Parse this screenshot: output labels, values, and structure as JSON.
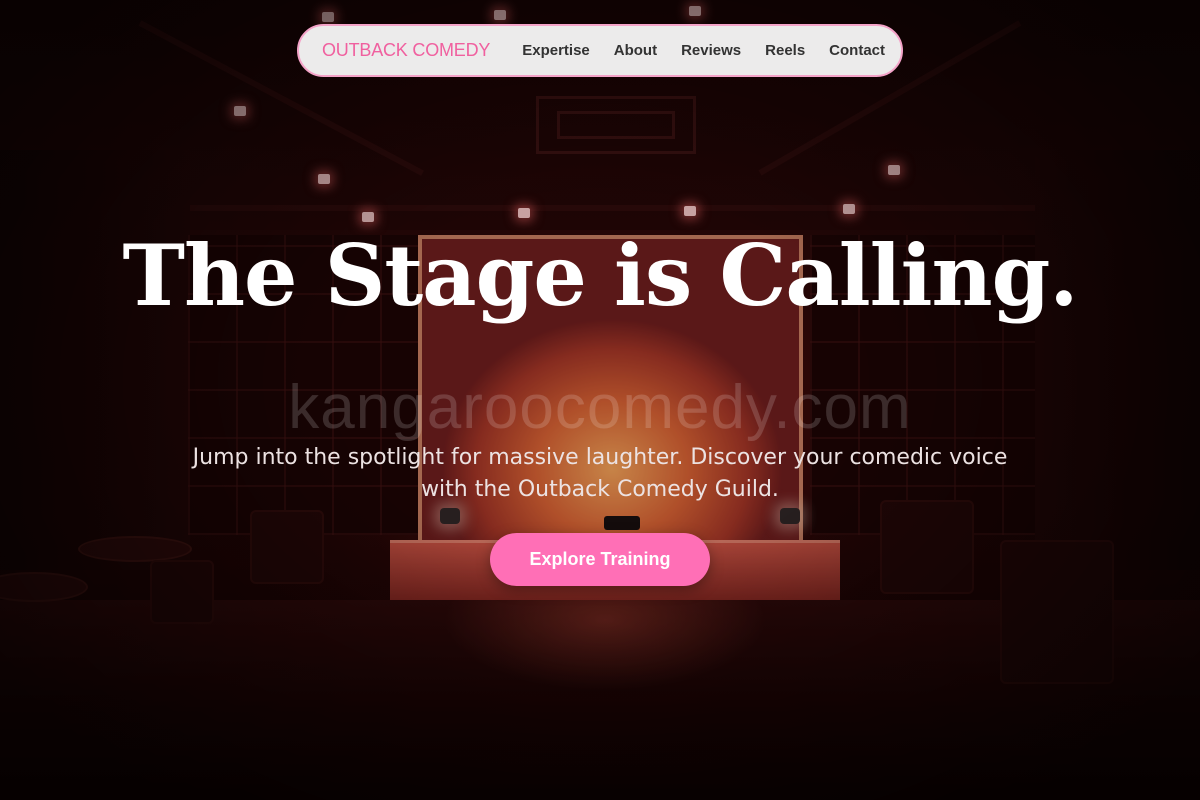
{
  "nav": {
    "brand": "OUTBACK COMEDY",
    "links": [
      {
        "label": "Expertise"
      },
      {
        "label": "About"
      },
      {
        "label": "Reviews"
      },
      {
        "label": "Reels"
      },
      {
        "label": "Contact"
      }
    ]
  },
  "hero": {
    "headline": "The Stage is Calling.",
    "subheadline": "Jump into the spotlight for massive laughter. Discover your comedic voice with the Outback Comedy Guild.",
    "cta_label": "Explore Training",
    "watermark": "kangaroocomedy.com",
    "background_image": "dark comedy club stage with red-orange spotlight"
  },
  "colors": {
    "accent_pink": "#ff6fb6",
    "brand_pink": "#f0609f",
    "nav_border": "#f4a3c8",
    "nav_text": "#333333",
    "headline": "#ffffff"
  }
}
